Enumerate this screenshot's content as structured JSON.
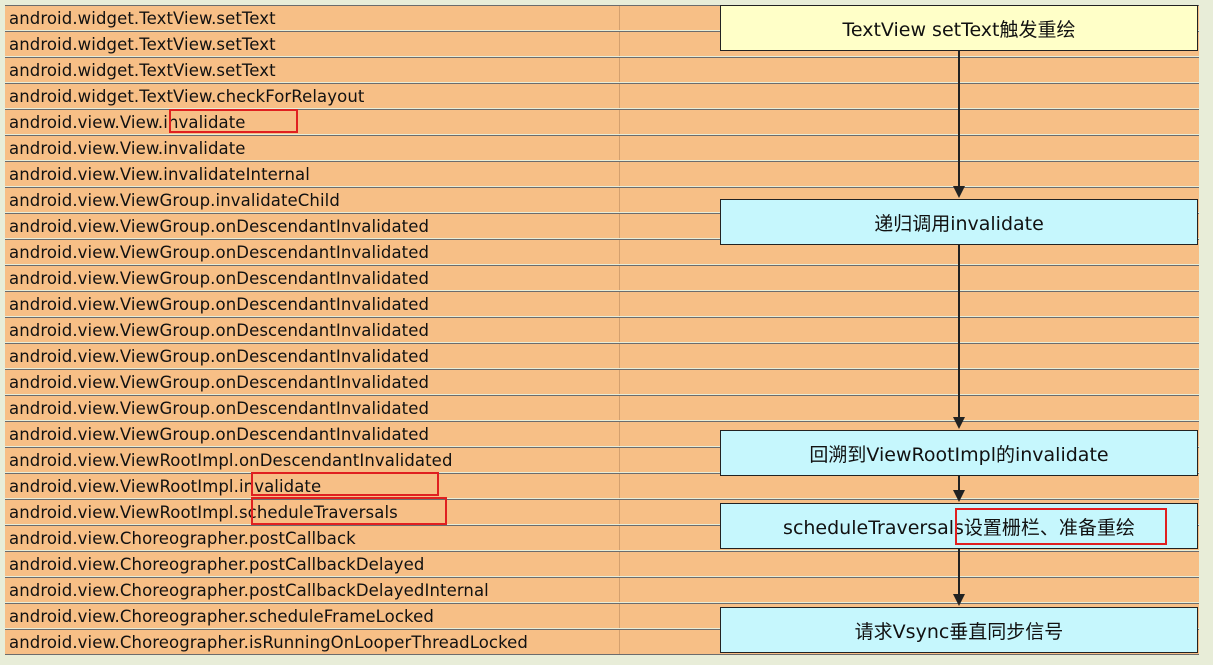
{
  "rows": [
    "android.widget.TextView.setText",
    "android.widget.TextView.setText",
    "android.widget.TextView.setText",
    "android.widget.TextView.checkForRelayout",
    "android.view.View.invalidate",
    "android.view.View.invalidate",
    "android.view.View.invalidateInternal",
    "android.view.ViewGroup.invalidateChild",
    "android.view.ViewGroup.onDescendantInvalidated",
    "android.view.ViewGroup.onDescendantInvalidated",
    "android.view.ViewGroup.onDescendantInvalidated",
    "android.view.ViewGroup.onDescendantInvalidated",
    "android.view.ViewGroup.onDescendantInvalidated",
    "android.view.ViewGroup.onDescendantInvalidated",
    "android.view.ViewGroup.onDescendantInvalidated",
    "android.view.ViewGroup.onDescendantInvalidated",
    "android.view.ViewGroup.onDescendantInvalidated",
    "android.view.ViewRootImpl.onDescendantInvalidated",
    "android.view.ViewRootImpl.invalidate",
    "android.view.ViewRootImpl.scheduleTraversals",
    "android.view.Choreographer.postCallback",
    "android.view.Choreographer.postCallbackDelayed",
    "android.view.Choreographer.postCallbackDelayedInternal",
    "android.view.Choreographer.scheduleFrameLocked",
    "android.view.Choreographer.isRunningOnLooperThreadLocked"
  ],
  "callouts": [
    {
      "text": "TextView setText触发重绘",
      "style": "yellow"
    },
    {
      "text": "递归调用invalidate",
      "style": "cyan"
    },
    {
      "text": "回溯到ViewRootImpl的invalidate",
      "style": "cyan"
    },
    {
      "text": "scheduleTraversals设置栅栏、准备重绘",
      "style": "cyan"
    },
    {
      "text": "请求Vsync垂直同步信号",
      "style": "cyan"
    }
  ],
  "colors": {
    "row_fill": "#f7bf86",
    "callout_yellow": "#ffffc8",
    "callout_cyan": "#c6f7fd",
    "highlight_border": "#e02020",
    "background": "#e8edd8"
  }
}
